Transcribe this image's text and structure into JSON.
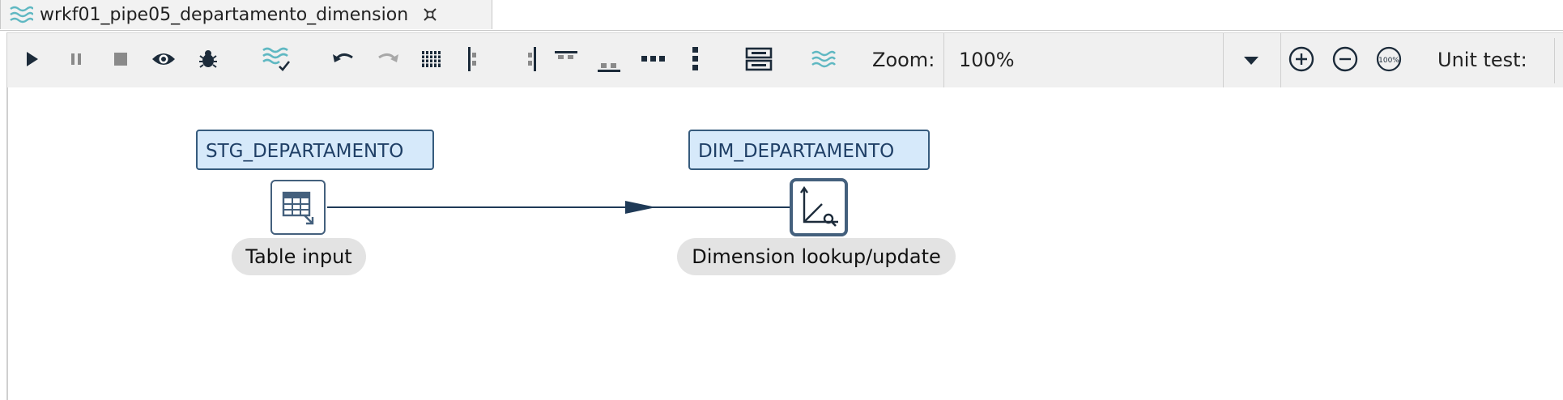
{
  "tab": {
    "title": "wrkf01_pipe05_departamento_dimension",
    "icon": "pipeline-waves-icon",
    "close_icon": "close-icon"
  },
  "toolbar": {
    "buttons": [
      {
        "name": "run-button",
        "icon": "play-icon"
      },
      {
        "name": "pause-button",
        "icon": "pause-icon"
      },
      {
        "name": "stop-button",
        "icon": "stop-icon"
      },
      {
        "name": "preview-button",
        "icon": "eye-icon"
      },
      {
        "name": "debug-button",
        "icon": "bug-icon"
      },
      {
        "name": "check-pipeline-button",
        "icon": "waves-check-icon"
      },
      {
        "name": "undo-button",
        "icon": "undo-icon"
      },
      {
        "name": "redo-button",
        "icon": "redo-icon"
      },
      {
        "name": "snap-to-grid-button",
        "icon": "grid-icon"
      },
      {
        "name": "align-left-button",
        "icon": "align-left-icon"
      },
      {
        "name": "align-right-button",
        "icon": "align-right-icon"
      },
      {
        "name": "align-top-button",
        "icon": "align-top-icon"
      },
      {
        "name": "align-bottom-button",
        "icon": "align-bottom-icon"
      },
      {
        "name": "distribute-horizontally-button",
        "icon": "distribute-horizontal-icon"
      },
      {
        "name": "distribute-vertically-button",
        "icon": "distribute-vertical-icon"
      },
      {
        "name": "layout-button",
        "icon": "layout-icon"
      },
      {
        "name": "pipeline-waves-button",
        "icon": "waves-icon"
      }
    ],
    "zoom_label": "Zoom:",
    "zoom_value": "100%",
    "zoom_dropdown_icon": "chevron-down-icon",
    "zoom_in_icon": "zoom-in-icon",
    "zoom_out_icon": "zoom-out-icon",
    "zoom_100_icon": "zoom-100-icon",
    "unit_test_label": "Unit test:"
  },
  "canvas": {
    "steps": [
      {
        "title": "STG_DEPARTAMENTO",
        "label": "Table input",
        "icon": "table-input-icon"
      },
      {
        "title": "DIM_DEPARTAMENTO",
        "label": "Dimension lookup/update",
        "icon": "dimension-lookup-icon"
      }
    ],
    "hop": {
      "from": "STG_DEPARTAMENTO",
      "to": "DIM_DEPARTAMENTO",
      "color": "#1f3a57"
    }
  },
  "colors": {
    "title_bg": "#d6e9fa",
    "title_border": "#365b7d",
    "title_text": "#1f3f66",
    "label_bg": "#e3e3e3",
    "waves_accent": "#5fb8c2"
  }
}
